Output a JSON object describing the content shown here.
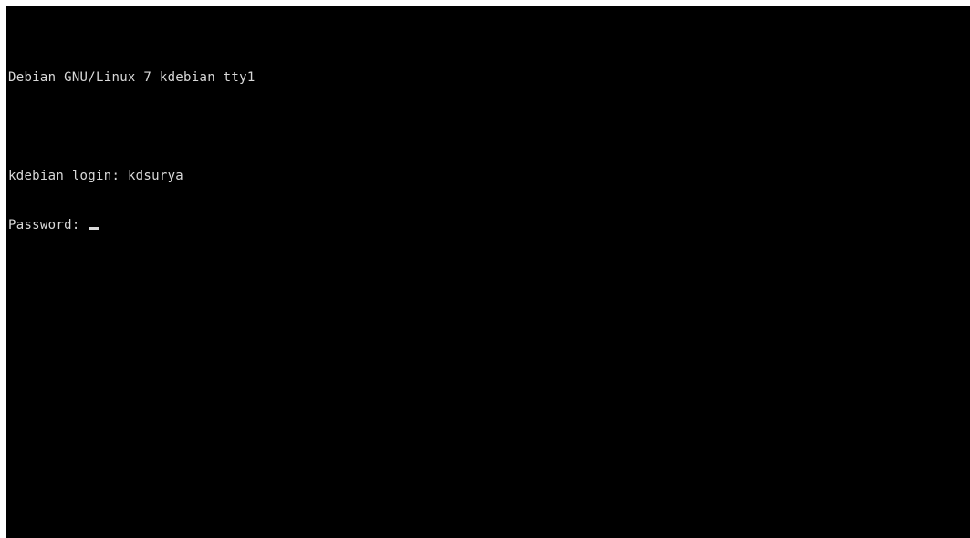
{
  "terminal": {
    "banner": "Debian GNU/Linux 7 kdebian tty1",
    "login_prompt": "kdebian login: ",
    "login_value": "kdsurya",
    "password_prompt": "Password: ",
    "password_value": ""
  },
  "colors": {
    "background": "#000000",
    "text": "#d9d9d9"
  }
}
